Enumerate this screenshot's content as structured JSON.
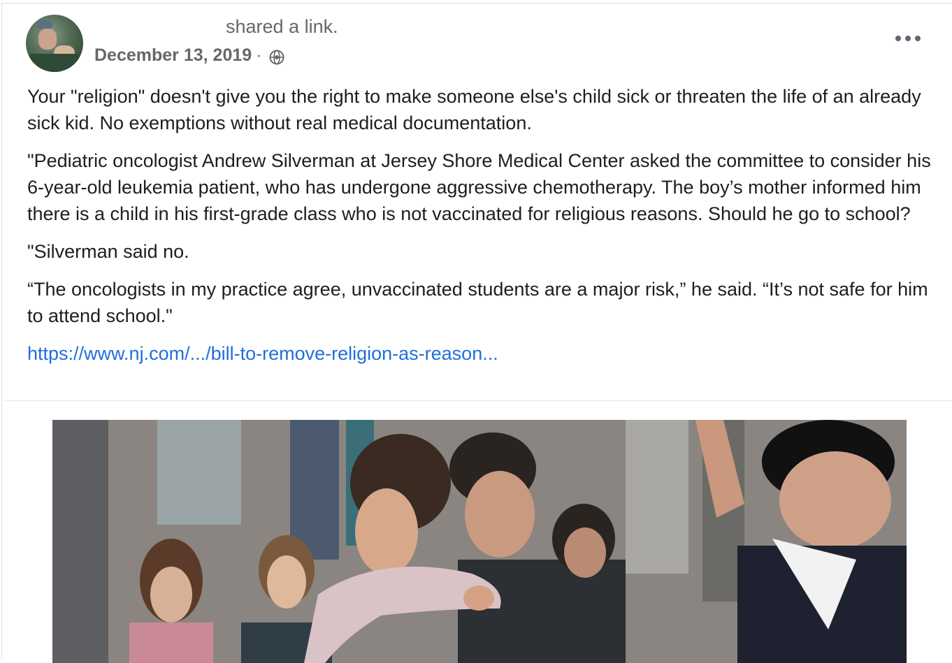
{
  "post": {
    "shared_text": "shared a link.",
    "date": "December 13, 2019",
    "separator": "·",
    "privacy_icon": "globe-icon",
    "more_icon": "more-options-icon",
    "paragraphs": [
      "Your \"religion\" doesn't give you the right to make someone else's child sick or threaten the life of an already sick kid. No exemptions without real medical documentation.",
      "\"Pediatric oncologist Andrew Silverman at Jersey Shore Medical Center asked the committee to consider his 6-year-old leukemia patient, who has undergone aggressive chemotherapy. The boy’s mother informed him there is a child in his first-grade class who is not vaccinated for religious reasons. Should he go to school?",
      "\"Silverman said no.",
      "“The oncologists in my practice agree, unvaccinated students are a major risk,” he said. “It’s not safe for him to attend school.\""
    ],
    "link_text": "https://www.nj.com/.../bill-to-remove-religion-as-reason..."
  },
  "colors": {
    "text": "#1c1e21",
    "meta": "#65676b",
    "link": "#216fdb"
  }
}
